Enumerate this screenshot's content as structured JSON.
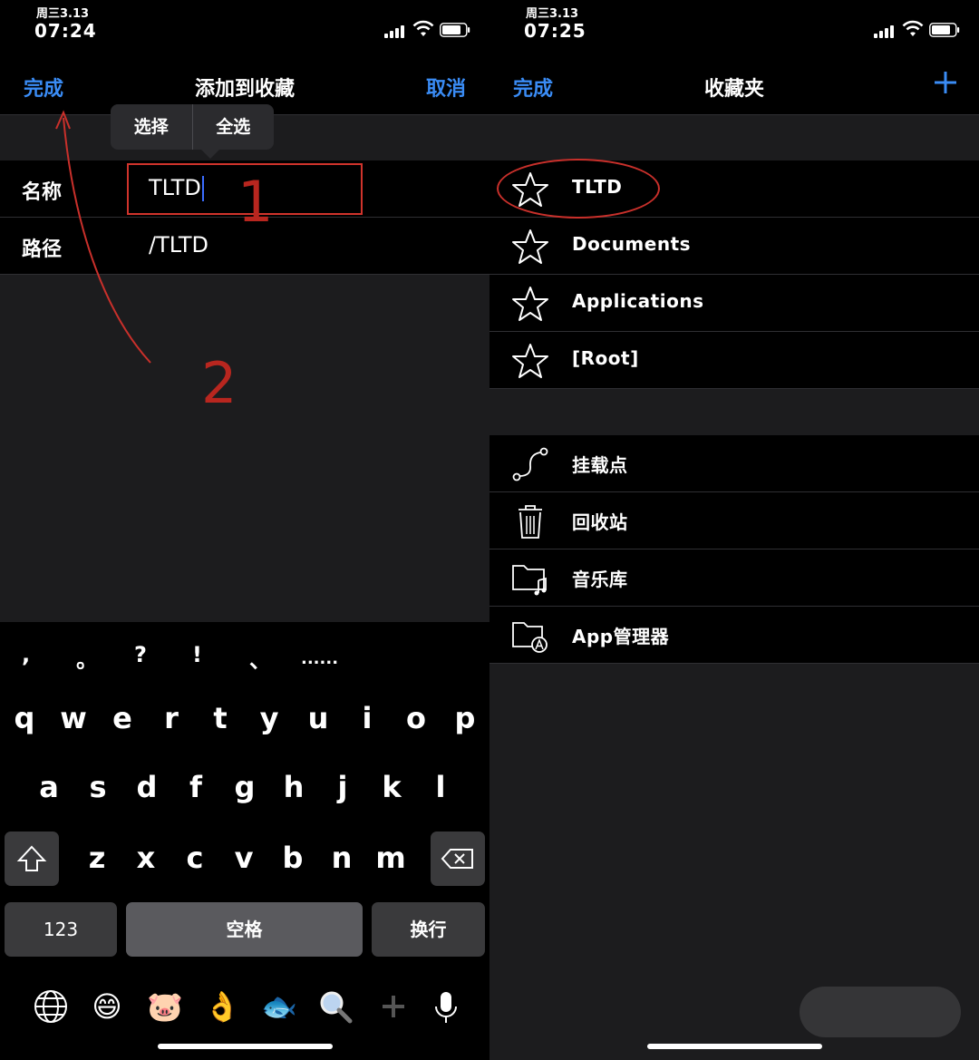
{
  "left": {
    "status": {
      "date": "周三3.13",
      "time": "07:24"
    },
    "nav": {
      "done": "完成",
      "title": "添加到收藏",
      "cancel": "取消"
    },
    "edit_menu": {
      "select": "选择",
      "select_all": "全选"
    },
    "form": {
      "name_label": "名称",
      "name_value": "TLTD",
      "path_label": "路径",
      "path_value": "/TLTD"
    },
    "annotations": {
      "step1": "1",
      "step2": "2"
    },
    "keyboard": {
      "punctuation": [
        ",",
        "。",
        "?",
        "!",
        "、",
        "......"
      ],
      "row1": [
        "q",
        "w",
        "e",
        "r",
        "t",
        "y",
        "u",
        "i",
        "o",
        "p"
      ],
      "row2": [
        "a",
        "s",
        "d",
        "f",
        "g",
        "h",
        "j",
        "k",
        "l"
      ],
      "row3": [
        "z",
        "x",
        "c",
        "v",
        "b",
        "n",
        "m"
      ],
      "num_key": "123",
      "space_key": "空格",
      "return_key": "换行",
      "emoji": [
        "😄",
        "🐷",
        "👌",
        "🐟"
      ]
    }
  },
  "right": {
    "status": {
      "date": "周三3.13",
      "time": "07:25"
    },
    "nav": {
      "done": "完成",
      "title": "收藏夹"
    },
    "favorites": [
      "TLTD",
      "Documents",
      "Applications",
      "[Root]"
    ],
    "locations": [
      "挂载点",
      "回收站",
      "音乐库",
      "App管理器"
    ]
  },
  "colors": {
    "accent": "#3a8cf5",
    "annotation": "#c9302b"
  }
}
